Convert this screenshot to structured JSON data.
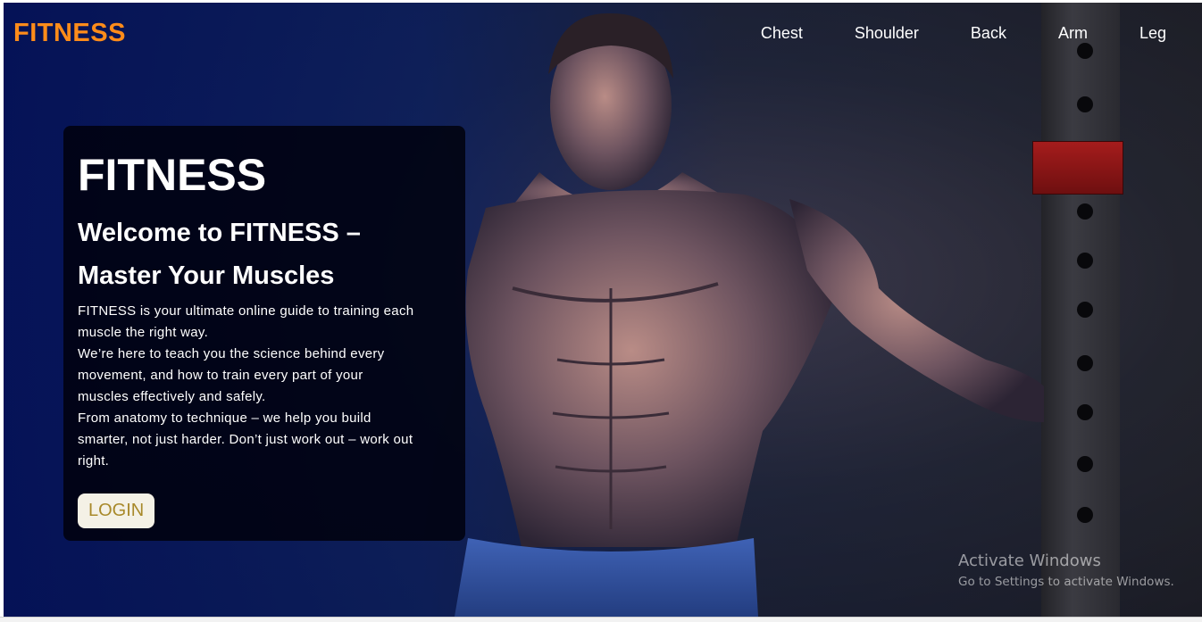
{
  "header": {
    "brand": "FITNESS",
    "nav": [
      {
        "label": "Chest"
      },
      {
        "label": "Shoulder"
      },
      {
        "label": "Back"
      },
      {
        "label": "Arm"
      },
      {
        "label": "Leg"
      }
    ]
  },
  "hero": {
    "title": "FITNESS",
    "subtitle_line1": "Welcome to FITNESS –",
    "subtitle_line2": "Master Your Muscles",
    "body_lines": [
      "FITNESS is your ultimate online guide to training each",
      "muscle the right way.",
      "We’re here to teach you the science behind every",
      "movement, and how to train every part of your",
      "muscles effectively and safely.",
      "From anatomy to technique – we help you build",
      "smarter, not just harder. Don’t just work out – work out",
      "right."
    ],
    "login_label": "LOGIN"
  },
  "watermark": {
    "title": "Activate Windows",
    "subtitle": "Go to Settings to activate Windows."
  },
  "colors": {
    "brand": "#ff8c1a",
    "login_text": "#a8892a",
    "login_bg": "#f4f1e6"
  }
}
